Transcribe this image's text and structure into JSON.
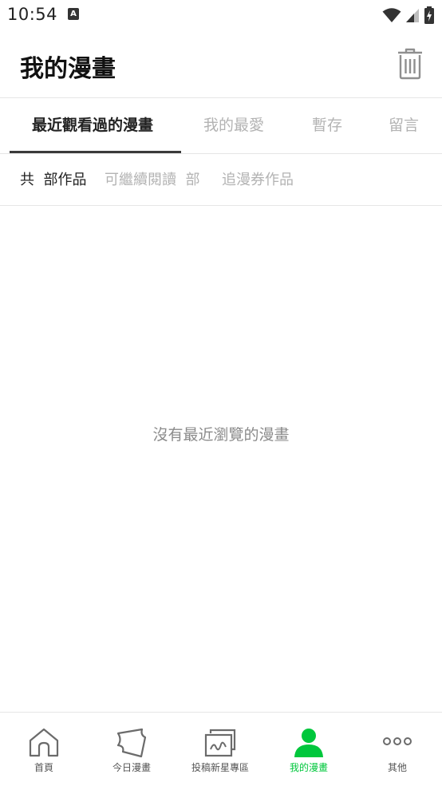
{
  "status_bar": {
    "time": "10:54",
    "notification_icon": "A"
  },
  "header": {
    "title": "我的漫畫",
    "trash_icon": "trash-icon"
  },
  "tabs": [
    {
      "label": "最近觀看過的漫畫",
      "active": true
    },
    {
      "label": "我的最愛",
      "active": false
    },
    {
      "label": "暫存",
      "active": false
    },
    {
      "label": "留言",
      "active": false
    }
  ],
  "filters": [
    {
      "label": "共  部作品",
      "active": true
    },
    {
      "label": "可繼續閱讀  部",
      "active": false
    },
    {
      "label": "追漫券作品",
      "active": false
    }
  ],
  "empty_message": "沒有最近瀏覽的漫畫",
  "bottom_nav": [
    {
      "label": "首頁",
      "icon": "home-icon",
      "active": false
    },
    {
      "label": "今日漫畫",
      "icon": "daily-comic-icon",
      "active": false
    },
    {
      "label": "投稿新星專區",
      "icon": "canvas-icon",
      "active": false
    },
    {
      "label": "我的漫畫",
      "icon": "person-icon",
      "active": true
    },
    {
      "label": "其他",
      "icon": "more-icon",
      "active": false
    }
  ],
  "colors": {
    "accent": "#00c73c",
    "inactive_text": "#b3b3b3",
    "active_text": "#222222",
    "icon_gray": "#6b6b6b"
  }
}
